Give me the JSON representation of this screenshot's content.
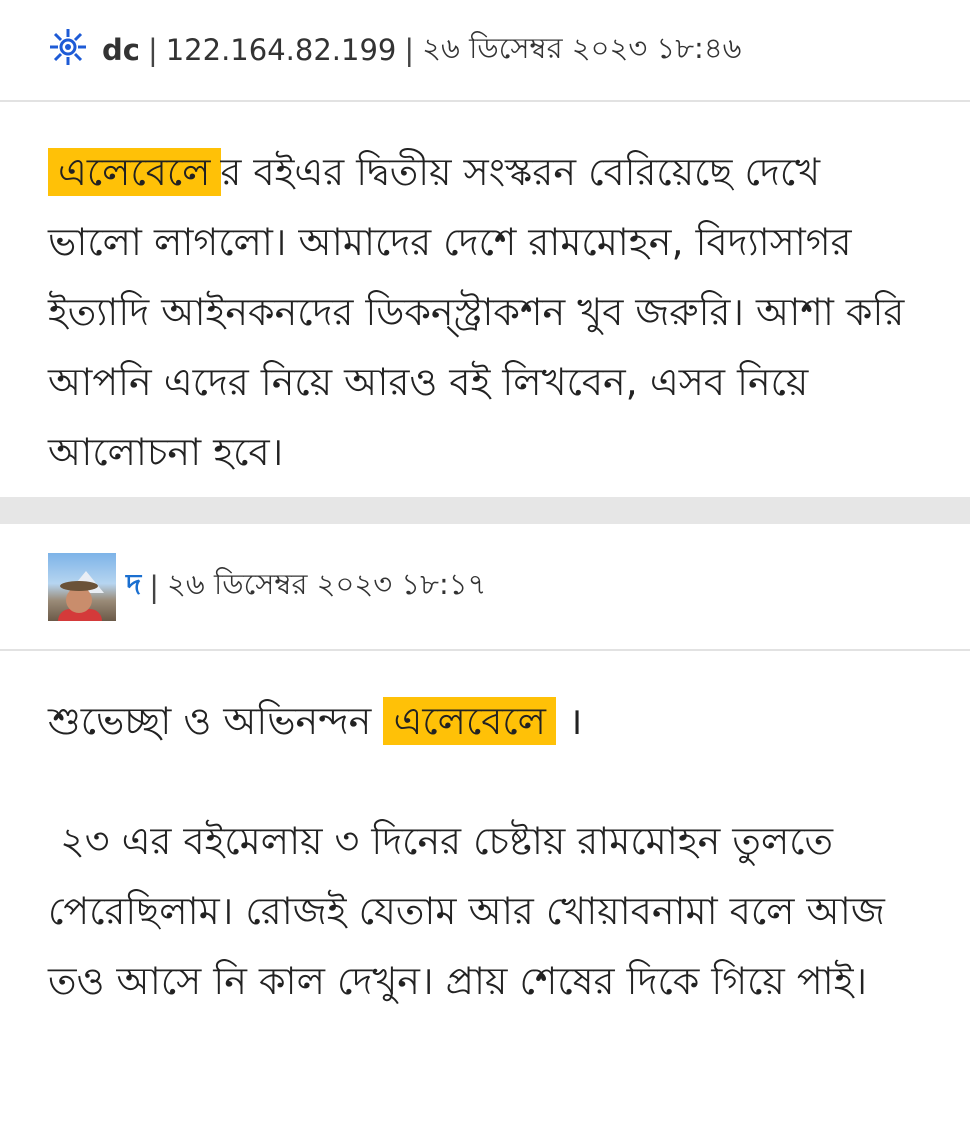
{
  "comments": [
    {
      "author": "dc",
      "ip": "122.164.82.199",
      "timestamp": "২৬ ডিসেম্বর ২০২৩ ১৮:৪৬",
      "icon": "gear-sun-icon",
      "mention": "এলেবেলে",
      "text": "র বইএর দ্বিতীয় সংস্করন বেরিয়েছে দেখে ভালো লাগলো। আমাদের দেশে রামমোহন, বিদ্যাসাগর ইত্যাদি আইনকনদের ডিকন্স্ট্রাকশন খুব জরুরি। আশা করি আপনি এদের নিয়ে আরও বই লিখবেন, এসব নিয়ে আলোচনা হবে।"
    },
    {
      "author": "দ",
      "timestamp": "২৬ ডিসেম্বর ২০২৩ ১৮:১৭",
      "icon": "user-avatar",
      "greeting_prefix": "শুভেচ্ছা ও অভিনন্দন",
      "mention": "এলেবেলে",
      "greeting_suffix": "।",
      "text": "২৩ এর বইমেলায় ৩ দিনের চেষ্টায় রামমোহন তুলতে পেরেছিলাম। রোজই যেতাম আর খোয়াবনামা বলে আজ তও আসে নি কাল দেখুন।   প্রায়  শেষের দিকে গিয়ে পাই।"
    }
  ],
  "colors": {
    "mention_bg": "#ffc107",
    "link": "#1a6fd0",
    "separator_band": "#e6e6e6"
  }
}
